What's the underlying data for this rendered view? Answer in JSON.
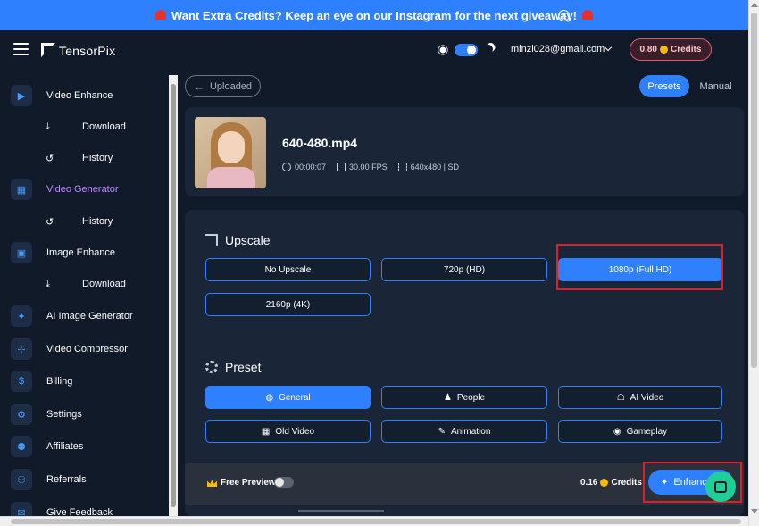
{
  "banner": {
    "text_before": "Want Extra Credits? Keep an eye on our",
    "link": "Instagram",
    "text_after": "for the next giveaway!",
    "close_glyph": "✕"
  },
  "header": {
    "logo_text": "TensorPix",
    "user_email": "minzi028@gmail.com",
    "credits_value": "0.80",
    "credits_label": "Credits",
    "accent_color": "#2f80ff"
  },
  "sidebar": {
    "items": [
      {
        "label": "Video Enhance",
        "icon": "video-camera-icon"
      },
      {
        "label": "Download",
        "icon": "download-icon"
      },
      {
        "label": "History",
        "icon": "history-icon"
      },
      {
        "label": "Video Generator",
        "icon": "film-icon"
      },
      {
        "label": "History",
        "icon": "history-icon"
      },
      {
        "label": "Image Enhance",
        "icon": "image-icon"
      },
      {
        "label": "Download",
        "icon": "download-icon"
      },
      {
        "label": "AI Image Generator",
        "icon": "magic-wand-icon"
      },
      {
        "label": "Video Compressor",
        "icon": "compress-icon"
      },
      {
        "label": "Billing",
        "icon": "dollar-icon"
      },
      {
        "label": "Settings",
        "icon": "gear-icon"
      },
      {
        "label": "Affiliates",
        "icon": "users-icon"
      },
      {
        "label": "Referrals",
        "icon": "referral-icon"
      },
      {
        "label": "Give Feedback",
        "icon": "chat-icon"
      }
    ]
  },
  "toolbar": {
    "back_label": "Uploaded",
    "tabs": [
      {
        "label": "Presets",
        "active": true
      },
      {
        "label": "Manual",
        "active": false
      }
    ]
  },
  "file": {
    "name": "640-480.mp4",
    "duration": "00:00:07",
    "fps": "30.00 FPS",
    "resolution": "640x480 | SD"
  },
  "upscale": {
    "title": "Upscale",
    "options": [
      "No Upscale",
      "720p (HD)",
      "1080p (Full HD)",
      "2160p (4K)"
    ],
    "selected": "1080p (Full HD)"
  },
  "preset": {
    "title": "Preset",
    "options": [
      {
        "label": "General",
        "icon": "globe-icon"
      },
      {
        "label": "People",
        "icon": "person-icon"
      },
      {
        "label": "AI Video",
        "icon": "robot-icon"
      },
      {
        "label": "Old Video",
        "icon": "film-icon"
      },
      {
        "label": "Animation",
        "icon": "brush-icon"
      },
      {
        "label": "Gameplay",
        "icon": "gamepad-icon"
      }
    ],
    "selected": "General"
  },
  "bottom_bar": {
    "free_preview_label": "Free Preview",
    "free_preview_on": false,
    "cost_value": "0.16",
    "cost_label": "Credits",
    "enhance_label": "Enhance"
  }
}
